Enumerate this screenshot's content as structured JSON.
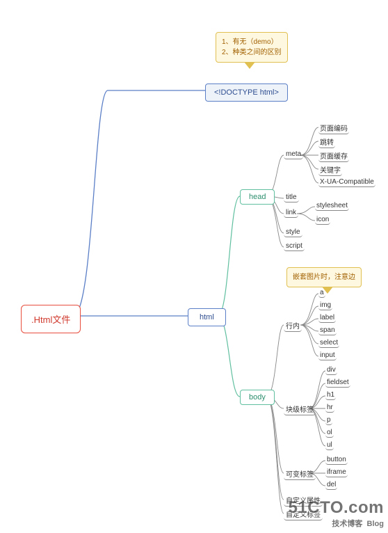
{
  "root": ".Html文件",
  "doctype": "<!DOCTYPE html>",
  "html_label": "html",
  "sections": {
    "head": "head",
    "body": "body"
  },
  "head_children": {
    "meta": "meta",
    "title": "title",
    "link": "link",
    "style": "style",
    "script": "script",
    "meta_leaves": [
      "页面编码",
      "跳转",
      "页面缓存",
      "关键字",
      "X-UA-Compatible"
    ],
    "link_leaves": [
      "stylesheet",
      "icon"
    ]
  },
  "body_children": {
    "inline": "行内",
    "block": "块级标签",
    "mutable": "可变标签",
    "custom_attr": "自定义属性",
    "custom_tag": "自定义标签",
    "inline_leaves": [
      "a",
      "img",
      "label",
      "span",
      "select",
      "input"
    ],
    "block_leaves": [
      "div",
      "fieldset",
      "h1",
      "hr",
      "p",
      "ol",
      "ul"
    ],
    "mutable_leaves": [
      "button",
      "iframe",
      "del"
    ]
  },
  "notes": {
    "doctype": "1、有无（demo）\n2、种类之间的区别",
    "a_tag": "嵌套图片时，注意边"
  },
  "watermark": {
    "main": "51CTO.com",
    "sub": "技术博客",
    "tag": "Blog"
  }
}
